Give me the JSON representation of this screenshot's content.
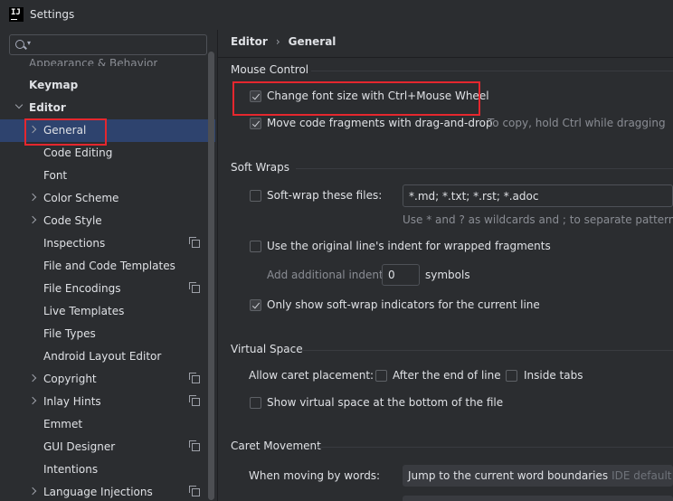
{
  "window": {
    "title": "Settings",
    "logo_text": "IJ"
  },
  "sidebar": {
    "search": {
      "value": "",
      "placeholder": ""
    },
    "cut_item": "Appearance & Behavior",
    "items": [
      {
        "label": "Keymap"
      },
      {
        "label": "Editor"
      },
      {
        "label": "General"
      },
      {
        "label": "Code Editing"
      },
      {
        "label": "Font"
      },
      {
        "label": "Color Scheme"
      },
      {
        "label": "Code Style"
      },
      {
        "label": "Inspections"
      },
      {
        "label": "File and Code Templates"
      },
      {
        "label": "File Encodings"
      },
      {
        "label": "Live Templates"
      },
      {
        "label": "File Types"
      },
      {
        "label": "Android Layout Editor"
      },
      {
        "label": "Copyright"
      },
      {
        "label": "Inlay Hints"
      },
      {
        "label": "Emmet"
      },
      {
        "label": "GUI Designer"
      },
      {
        "label": "Intentions"
      },
      {
        "label": "Language Injections"
      }
    ]
  },
  "breadcrumb": {
    "parent": "Editor",
    "sep": "›",
    "current": "General"
  },
  "mouse_control": {
    "title": "Mouse Control",
    "ctrl_wheel_label": "Change font size with Ctrl+Mouse Wheel",
    "drag_drop_label": "Move code fragments with drag-and-drop",
    "drag_drop_hint": "To copy, hold Ctrl while dragging"
  },
  "soft_wraps": {
    "title": "Soft Wraps",
    "soft_wrap_label": "Soft-wrap these files:",
    "file_patterns": "*.md; *.txt; *.rst; *.adoc",
    "patterns_hint": "Use * and ? as wildcards and ; to separate patterns",
    "original_indent_label": "Use the original line's indent for wrapped fragments",
    "add_indent_label": "Add additional indent:",
    "add_indent_value": "0",
    "add_indent_unit": "symbols",
    "indicators_label": "Only show soft-wrap indicators for the current line"
  },
  "virtual_space": {
    "title": "Virtual Space",
    "caret_label": "Allow caret placement:",
    "after_end_label": "After the end of line",
    "inside_tabs_label": "Inside tabs",
    "show_bottom_label": "Show virtual space at the bottom of the file"
  },
  "caret_movement": {
    "title": "Caret Movement",
    "moving_words_label": "When moving by words:",
    "moving_words_value": "Jump to the current word boundaries",
    "moving_words_default": "IDE default"
  },
  "colors": {
    "selection": "#2e436e",
    "highlight": "#e5272e",
    "background": "#2b2d30"
  }
}
